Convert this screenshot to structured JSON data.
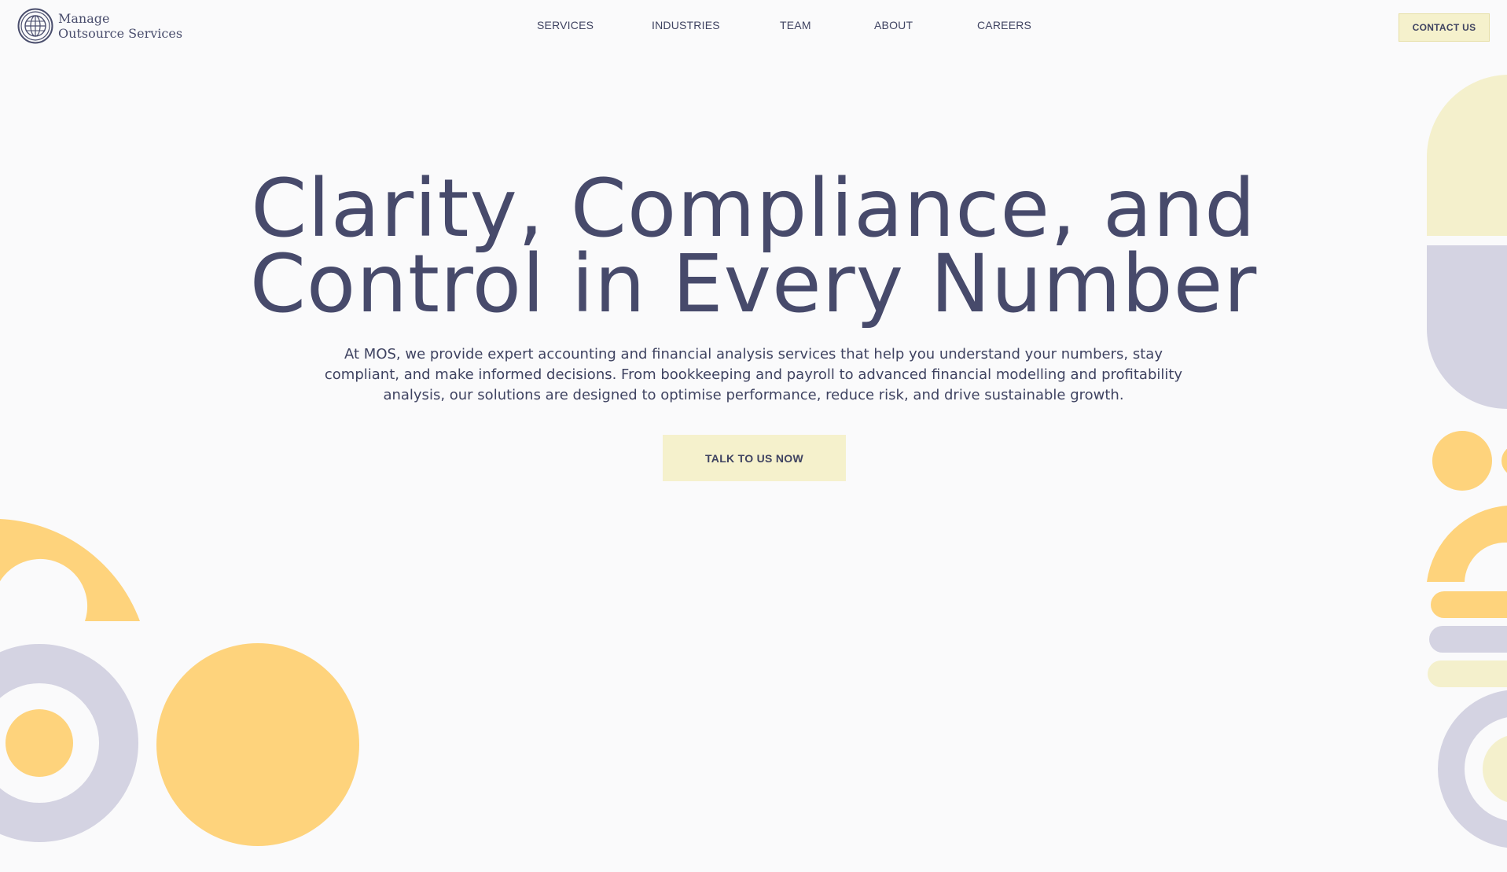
{
  "brand": {
    "line1": "Manage",
    "line2": "Outsource Services",
    "logo_icon": "globe-icon"
  },
  "nav": {
    "items": [
      {
        "label": "SERVICES"
      },
      {
        "label": "INDUSTRIES"
      },
      {
        "label": "TEAM"
      },
      {
        "label": "ABOUT"
      },
      {
        "label": "CAREERS"
      }
    ],
    "contact_label": "CONTACT US"
  },
  "hero": {
    "title_line1": "Clarity, Compliance, and",
    "title_line2": "Control in Every Number",
    "description": "At MOS, we provide expert accounting and financial analysis services that help you understand your numbers, stay compliant, and make informed decisions. From bookkeeping and payroll to advanced financial modelling and profitability analysis, our solutions are designed to optimise performance, reduce risk, and drive sustainable growth.",
    "cta_label": "TALK TO US NOW"
  },
  "colors": {
    "background": "#fafafb",
    "text": "#474a6b",
    "button": "#f5f1cc",
    "yellow": "#fed37c",
    "lavender": "#d4d3e2",
    "pale_yellow": "#f4f0cc"
  }
}
